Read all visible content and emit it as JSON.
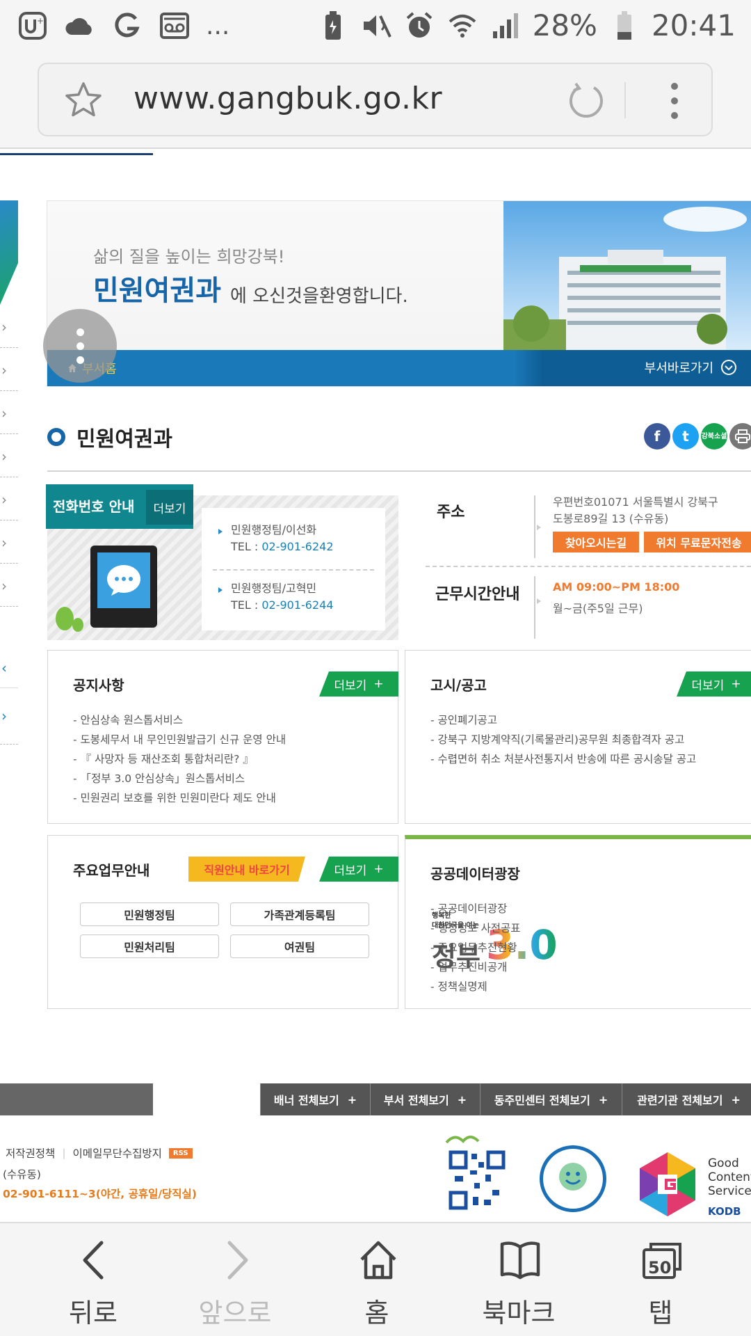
{
  "status_bar": {
    "left_icons": [
      "u-plus-icon",
      "cloud-icon",
      "google-icon",
      "voicemail-icon"
    ],
    "more": "...",
    "battery_percent": "28%",
    "time": "20:41"
  },
  "browser": {
    "url": "www.gangbuk.go.kr"
  },
  "banner": {
    "slogan": "삶의 질을 높이는 희망강북!",
    "dept_name": "민원여권과",
    "welcome": "에 오신것을환영합니다.",
    "home_link": "부서홈",
    "dept_shortcut": "부서바로가기"
  },
  "section": {
    "title": "민원여권과",
    "social": [
      "f",
      "t",
      "강북소셜",
      "print"
    ]
  },
  "phone_info": {
    "title": "전화번호 안내",
    "more": "더보기",
    "entries": [
      {
        "name": "민원행정팀/이선화",
        "tel_label": "TEL : ",
        "tel": "02-901-6242"
      },
      {
        "name": "민원행정팀/고혁민",
        "tel_label": "TEL : ",
        "tel": "02-901-6244"
      }
    ]
  },
  "address": {
    "label": "주소",
    "line1": "우편번호01071 서울특별시 강북구",
    "line2": "도봉로89길 13 (수유동)",
    "btn_directions": "찾아오시는길",
    "btn_sms": "위치 무료문자전송"
  },
  "work_hours": {
    "label": "근무시간안내",
    "hours": "AM 09:00~PM 18:00",
    "days": "월~금(주5일 근무)"
  },
  "notice": {
    "title": "공지사항",
    "more": "더보기",
    "items": [
      "- 안심상속 원스톱서비스",
      "- 도봉세무서 내 무인민원발급기 신규 운영 안내",
      "- 『 사망자 등 재산조회 통합처리란? 』",
      "- 「정부 3.0 안심상속」원스톱서비스",
      "- 민원권리 보호를 위한 민원미란다 제도 안내"
    ]
  },
  "announce": {
    "title": "고시/공고",
    "more": "더보기",
    "items": [
      "- 공인폐기공고",
      "- 강북구 지방계약직(기록물관리)공무원 최종합격자 공고",
      "- 수렵면허 취소 처분사전통지서 반송에 따른 공시송달 공고"
    ]
  },
  "main_work": {
    "title": "주요업무안내",
    "staff_link": "직원안내 바로가기",
    "more": "더보기",
    "teams": [
      "민원행정팀",
      "가족관계등록팀",
      "민원처리팀",
      "여권팀"
    ]
  },
  "public_data": {
    "title": "공공데이터광장",
    "gov_small1": "행복한",
    "gov_small2": "대한민국을 여는",
    "gov_big": "정부",
    "gov_version": "3.0",
    "links": [
      "- 공공데이터광장",
      "- 행정정보 사전공표",
      "- 주요업무추진현황",
      "- 업무추진비공개",
      "- 정책실명제"
    ]
  },
  "footer_tabs": [
    "배너 전체보기",
    "부서 전체보기",
    "동주민센터 전체보기",
    "관련기관 전체보기"
  ],
  "footer": {
    "copyright_policy": "저작권정책",
    "email_policy": "이메일무단수집방지",
    "rss": "RSS",
    "address_tail": "(수유동)",
    "tel": "02-901-6111~3(야간, 공휴일/당직실)",
    "gcs": [
      "Good",
      "Content",
      "Service"
    ],
    "kodb": "KODB"
  },
  "bottom_nav": [
    {
      "label": "뒤로",
      "enabled": true
    },
    {
      "label": "앞으로",
      "enabled": false
    },
    {
      "label": "홈",
      "enabled": true
    },
    {
      "label": "북마크",
      "enabled": true
    },
    {
      "label": "탭",
      "count": "50",
      "enabled": true
    }
  ],
  "colors": {
    "brand_blue": "#1565a8",
    "teal": "#10868f",
    "green": "#16a24f",
    "orange": "#f07a2e"
  }
}
